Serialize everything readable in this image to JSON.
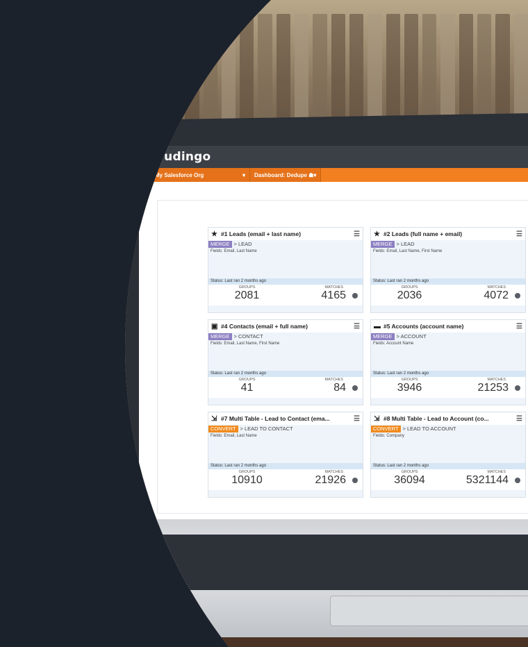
{
  "app": {
    "logo": "cloudingo"
  },
  "toolbar": {
    "org_label": "My Salesforce Org",
    "org_chevron": "▾",
    "dashboard_label": "Dashboard: Dedupe",
    "dashboard_icon": "user-group-icon",
    "dashboard_chevron": "▾"
  },
  "cards": [
    {
      "icon": "star-icon",
      "title": "#1 Leads (email + last name)",
      "action": "MERGE",
      "target": "> LEAD",
      "fields": "Fields: Email, Last Name",
      "status": "Status: Last ran 2 months ago",
      "groups_label": "GROUPS",
      "groups": "2081",
      "matches_label": "MATCHES",
      "matches": "4165"
    },
    {
      "icon": "star-icon",
      "title": "#2 Leads (full name + email)",
      "action": "MERGE",
      "target": "> LEAD",
      "fields": "Fields: Email, Last Name, First Name",
      "status": "Status: Last ran 2 months ago",
      "groups_label": "GROUPS",
      "groups": "2036",
      "matches_label": "MATCHES",
      "matches": "4072"
    },
    {
      "icon": "contact-card-icon",
      "title": "#4 Contacts (email + full name)",
      "action": "MERGE",
      "target": "> CONTACT",
      "fields": "Fields: Email, Last Name, First Name",
      "status": "Status: Last ran 2 months ago",
      "groups_label": "GROUPS",
      "groups": "41",
      "matches_label": "MATCHES",
      "matches": "84"
    },
    {
      "icon": "folder-icon",
      "title": "#5 Accounts (account name)",
      "action": "MERGE",
      "target": "> ACCOUNT",
      "fields": "Fields: Account Name",
      "status": "Status: Last ran 2 months ago",
      "groups_label": "GROUPS",
      "groups": "3946",
      "matches_label": "MATCHES",
      "matches": "21253"
    },
    {
      "icon": "multi-table-icon",
      "title": "#7 Multi Table - Lead to Contact (ema...",
      "action": "CONVERT",
      "target": "> LEAD TO CONTACT",
      "fields": "Fields: Email, Last Name",
      "status": "Status: Last ran 2 months ago",
      "groups_label": "GROUPS",
      "groups": "10910",
      "matches_label": "MATCHES",
      "matches": "21926"
    },
    {
      "icon": "multi-table-icon",
      "title": "#8 Multi Table - Lead to Account (co...",
      "action": "CONVERT",
      "target": "> LEAD TO ACCOUNT",
      "fields": "Fields: Company",
      "status": "Status: Last ran 2 months ago",
      "groups_label": "GROUPS",
      "groups": "36094",
      "matches_label": "MATCHES",
      "matches": "5321144"
    }
  ],
  "colors": {
    "accent": "#f27f20",
    "merge": "#8c7fc2",
    "convert": "#f08a1d",
    "page_bg": "#1c222c"
  }
}
